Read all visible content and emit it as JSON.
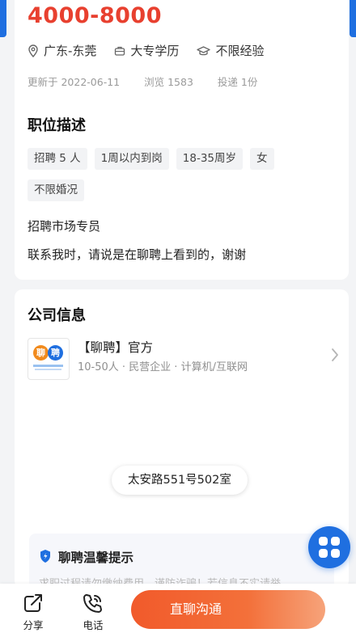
{
  "colors": {
    "accent": "#1f6fe0",
    "salary": "#e8402f",
    "cta": "#f15a2b"
  },
  "job": {
    "salary": "4000-8000",
    "location": "广东-东莞",
    "education": "大专学历",
    "experience": "不限经验",
    "updated": "更新于 2022-06-11",
    "views": "浏览 1583",
    "applications": "投递 1份"
  },
  "description": {
    "title": "职位描述",
    "tags": [
      "招聘 5 人",
      "1周以内到岗",
      "18-35周岁",
      "女",
      "不限婚况"
    ],
    "lines": [
      "招聘市场专员",
      "联系我时，请说是在聊聘上看到的，谢谢"
    ]
  },
  "company": {
    "section_title": "公司信息",
    "name": "【聊聘】官方",
    "info": "10-50人 · 民营企业 · 计算机/互联网",
    "logo_chars": [
      "聊",
      "聘"
    ],
    "address": "太安路551号502室"
  },
  "tip": {
    "title": "聊聘温馨提示",
    "text": "求职过程请勿缴纳费用，谨防诈骗！若信息不实请举"
  },
  "bottom": {
    "share": "分享",
    "phone": "电话",
    "cta": "直聊沟通"
  },
  "icons": {
    "location": "location-pin-icon",
    "education": "briefcase-icon",
    "experience": "graduation-cap-icon",
    "chevron": "chevron-right-icon",
    "shield": "shield-icon",
    "fab": "grid-icon",
    "share": "share-icon",
    "phone": "phone-icon"
  }
}
